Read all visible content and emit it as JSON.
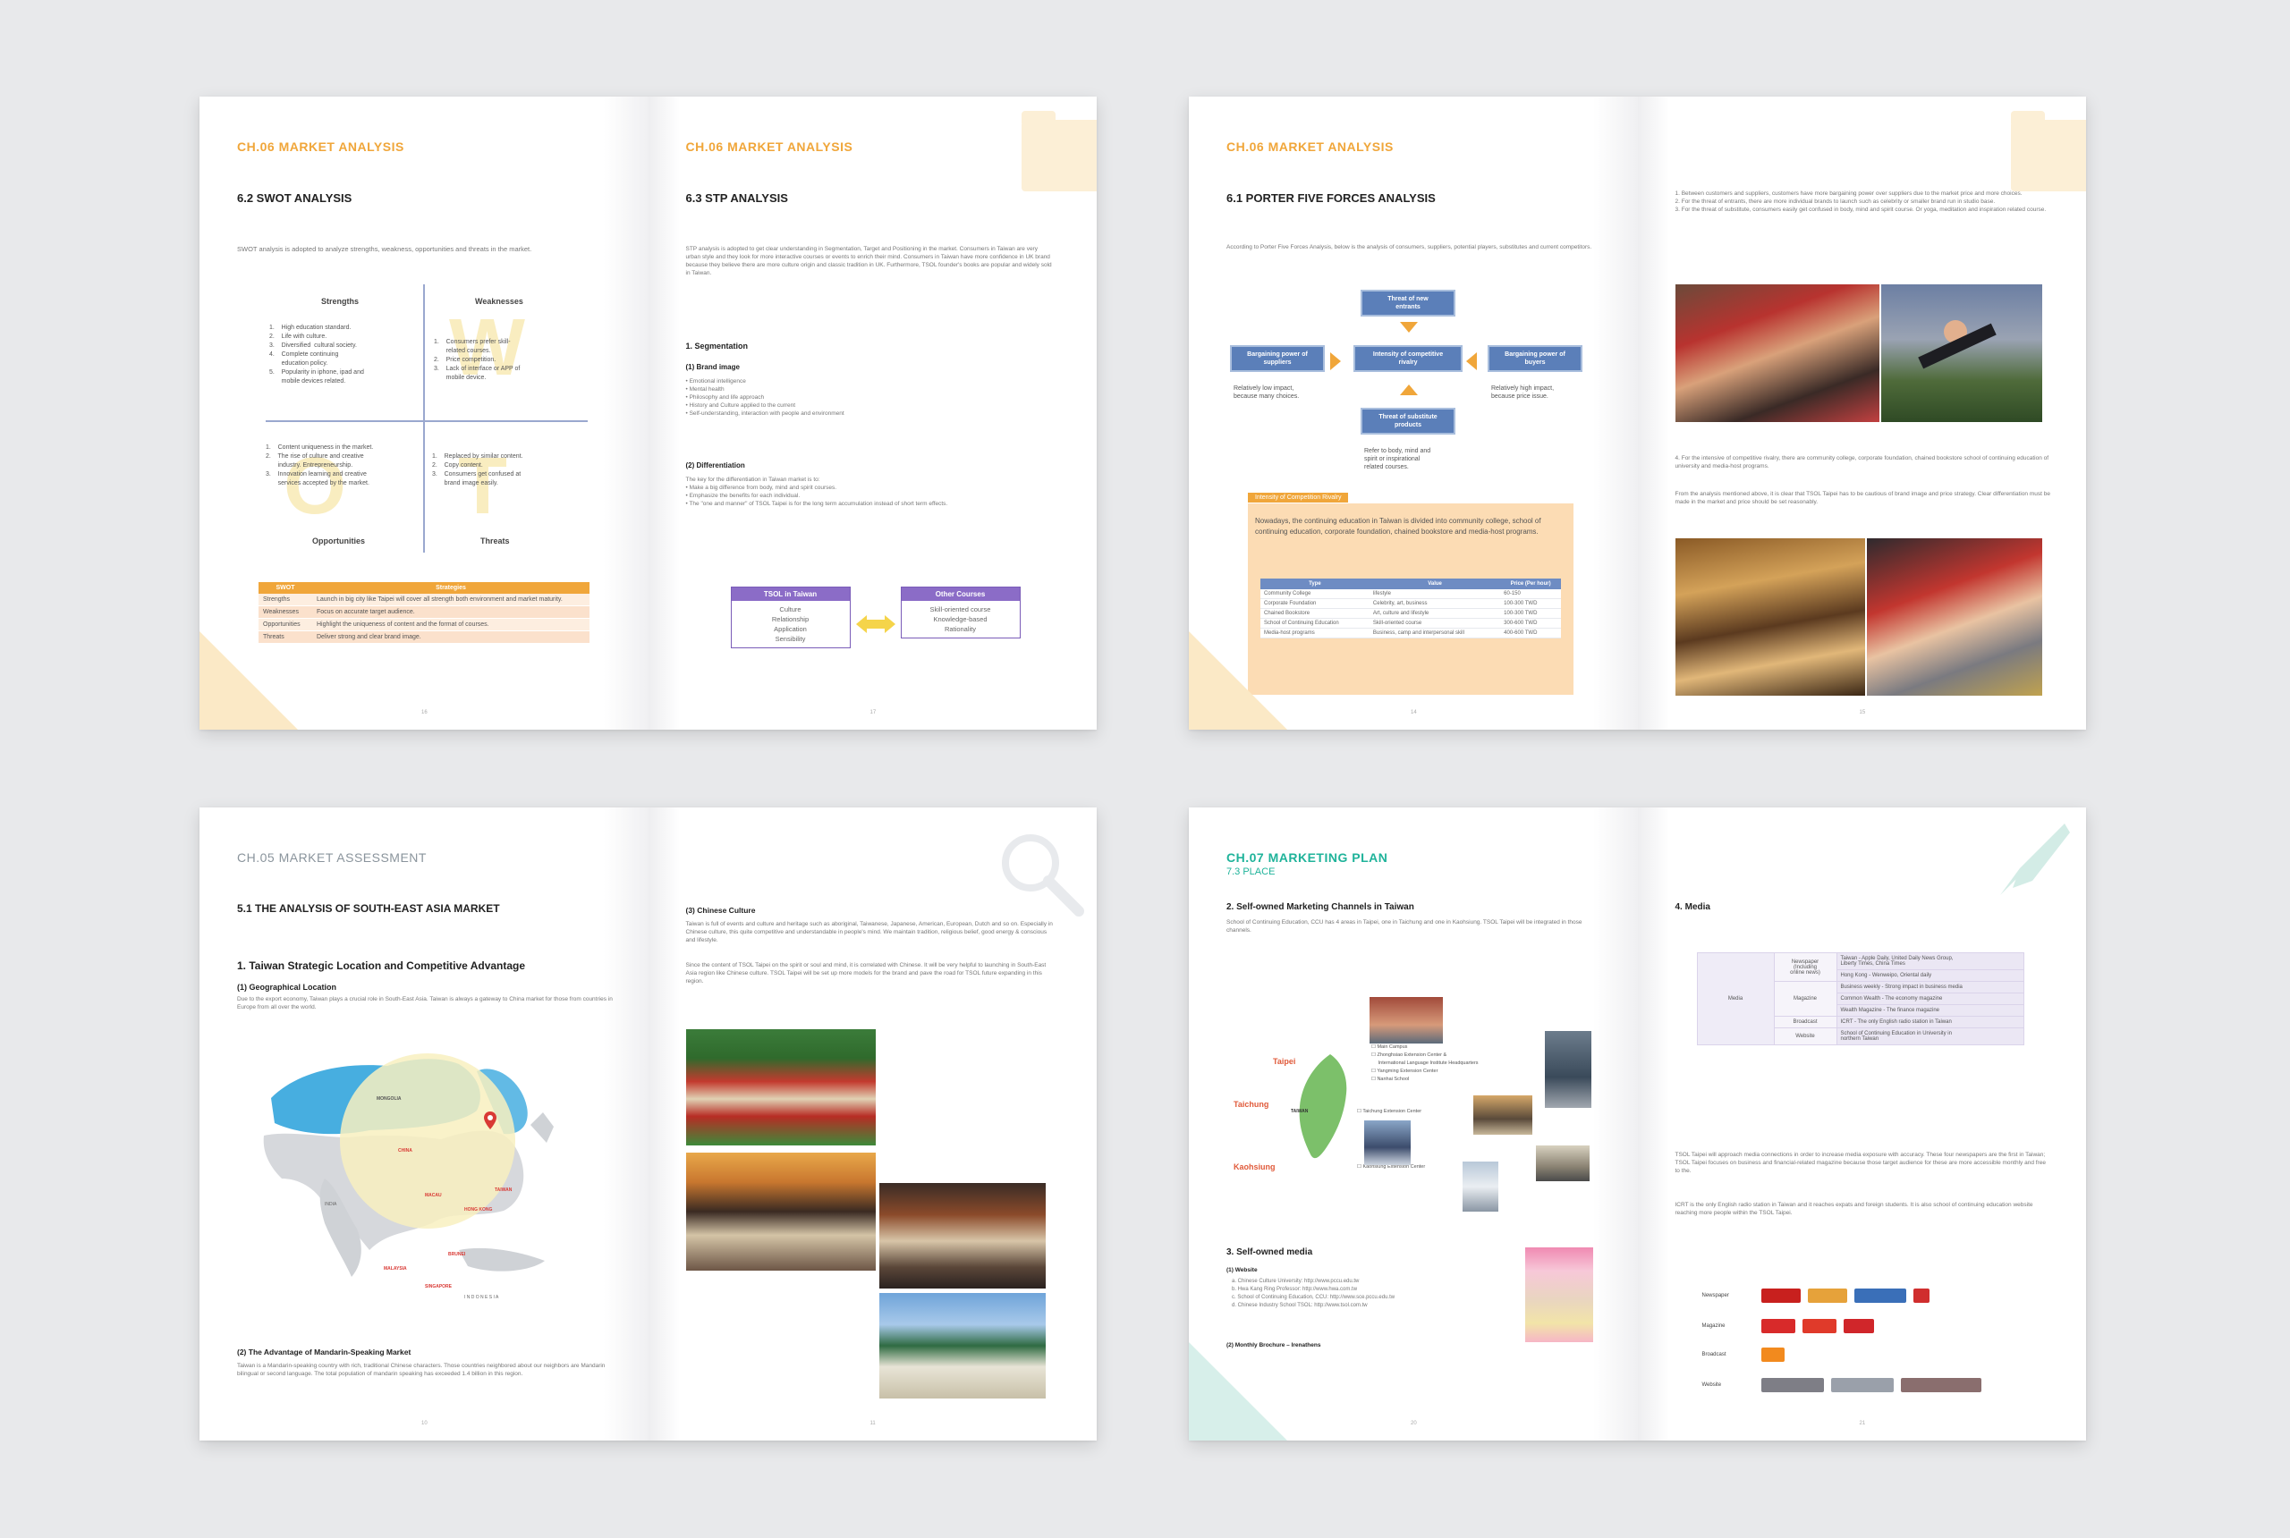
{
  "spread1": {
    "left": {
      "chapter": "CH.06  MARKET ANALYSIS",
      "section": "6.2  SWOT ANALYSIS",
      "intro": "SWOT analysis is adopted to analyze strengths, weakness, opportunities and threats in the market.",
      "quadrants": {
        "strengths": "Strengths",
        "weaknesses": "Weaknesses",
        "opportunities": "Opportunities",
        "threats": "Threats"
      },
      "strengths_list": "1.    High education standard.\n2.    Life with culture.\n3.    Diversified  cultural society.\n4.    Complete continuing\n       education policy.\n5.    Popularity in iphone, ipad and\n       mobile devices related.",
      "weaknesses_list": "1.    Consumers prefer skill-\n       related courses.\n2.    Price competition.\n3.    Lack of interface or APP of\n       mobile device.",
      "opportunities_list": "1.    Content uniqueness in the market.\n2.    The rise of culture and creative\n       industry. Entrepreneurship.\n3.    Innovation learning and creative\n       services accepted by the market.",
      "threats_list": "1.    Replaced by similar content.\n2.    Copy content.\n3.    Consumers get confused at\n       brand image easily.",
      "table_headers": [
        "SWOT",
        "Strategies"
      ],
      "table_rows": [
        [
          "Strengths",
          "Launch in big city like Taipei will cover all strength both environment and market maturity."
        ],
        [
          "Weaknesses",
          "Focus on accurate target audience."
        ],
        [
          "Opportunities",
          "Highlight the uniqueness of content and the format of courses."
        ],
        [
          "Threats",
          "Deliver strong and clear brand image."
        ]
      ],
      "page_number": "16"
    },
    "right": {
      "chapter": "CH.06  MARKET ANALYSIS",
      "section": "6.3  STP ANALYSIS",
      "intro": "STP analysis is adopted to get clear understanding in Segmentation, Target and Positioning in the market. Consumers in Taiwan are very urban style and they look for more interactive courses or events to enrich their mind. Consumers in Taiwan have more confidence in UK brand because they believe there are more culture origin and classic tradition in UK. Furthermore, TSOL founder's books are popular and widely sold in Taiwan.",
      "seg_title": "1. Segmentation",
      "brand_title": "(1) Brand image",
      "brand_list": "• Emotional intelligence\n• Mental health\n• Philosophy and life approach\n• History and Culture applied to the current\n• Self-understanding, interaction with people and environment",
      "diff_title": "(2) Differentiation",
      "diff_text": "The key for the differentiation in Taiwan market is to:\n• Make a big difference from body, mind and spirit courses.\n• Emphasize the benefits for each individual.\n• The \"one and manner\" of TSOL Taipei is for the long term accumulation instead of short term effects.",
      "box1_title": "TSOL in Taiwan",
      "box1_items": "Culture\nRelationship\nApplication\nSensibility",
      "box2_title": "Other Courses",
      "box2_items": "Skill-oriented course\nKnowledge-based\nRationality",
      "page_number": "17"
    }
  },
  "spread2": {
    "left": {
      "chapter": "CH.06  MARKET ANALYSIS",
      "section": "6.1  PORTER FIVE FORCES ANALYSIS",
      "intro": "According to Porter Five Forces Analysis, below is the analysis of consumers, suppliers, potential players, substitutes and current competitors.",
      "boxes": {
        "new_entrants": "Threat of new\nentrants",
        "suppliers": "Bargaining power of\nsuppliers",
        "rivalry": "Intensity of competitive\nrivalry",
        "buyers": "Bargaining power of\nbuyers",
        "substitutes": "Threat of substitute\nproducts"
      },
      "supplier_note": "Relatively low impact,\nbecause many choices.",
      "buyer_note": "Relatively high impact,\nbecause price issue.",
      "substitute_note": "Refer to body, mind and\nspirit or inspirational\nrelated courses.",
      "note_tag": "Intensity of Competition Rivalry",
      "note_text": "Nowadays, the continuing education in Taiwan is divided into community college, school of continuing education, corporate foundation, chained bookstore and media-host programs.",
      "table_headers": [
        "Type",
        "Value",
        "Price (Per hour)"
      ],
      "table_rows": [
        [
          "Community College",
          "lifestyle",
          "60-150"
        ],
        [
          "Corporate Foundation",
          "Celebrity, art, business",
          "100-300 TWD"
        ],
        [
          "Chained Bookstore",
          "Art, culture and lifestyle",
          "100-300 TWD"
        ],
        [
          "School of Continuing Education",
          "Skill-oriented course",
          "300-600 TWD"
        ],
        [
          "Media-host programs",
          "Business, camp and interpersonal skill",
          "400-600 TWD"
        ]
      ],
      "page_number": "14"
    },
    "right": {
      "text1": "1. Between customers and suppliers, customers have more bargaining power over suppliers due to the market price and more choices.\n2. For the threat of entrants, there are more individual brands to launch such as celebrity or smaller brand run in studio base.\n3. For the threat of substitute, consumers easily get confused in body, mind and spirit course. Or yoga, meditation and inspiration related course.",
      "text2": "4. For the intensive of competitive rivalry, there are community college, corporate foundation, chained bookstore school of continuing education of university and media-host programs.",
      "text3": "From the analysis mentioned above, it is clear that TSOL Taipei has to be cautious of brand image and price strategy. Clear differentiation must be made in the market and price should be set reasonably.",
      "page_number": "15"
    }
  },
  "spread3": {
    "left": {
      "chapter": "CH.05  MARKET ASSESSMENT",
      "section": "5.1  THE ANALYSIS OF SOUTH-EAST ASIA MARKET",
      "sub1": "1. Taiwan Strategic Location and Competitive Advantage",
      "sub2": "(1) Geographical Location",
      "text1": "Due to the export economy, Taiwan plays a crucial role in South-East Asia. Taiwan is always a gateway to China market for those from countries in Europe from all over the world.",
      "map_labels": {
        "mongolia": "MONGOLIA",
        "china": "CHINA",
        "india": "INDIA",
        "taiwan": "TAIWAN",
        "macau": "MACAU",
        "hongkong": "HONG KONG",
        "brunei": "BRUNEI",
        "malaysia": "MALAYSIA",
        "singapore": "SINGAPORE",
        "indonesia": "I N D O N E S I A"
      },
      "sub3": "(2) The Advantage of Mandarin-Speaking Market",
      "text2": "Taiwan is a Mandarin-speaking country with rich, traditional Chinese characters. Those countries neighbored about our neighbors are Mandarin bilingual or second language. The total population of mandarin speaking has exceeded 1.4 billion in this region.",
      "page_number": "10"
    },
    "right": {
      "sub": "(3) Chinese Culture",
      "text1": "Taiwan is full of events and culture and heritage such as aboriginal, Taiwanese, Japanese, American, European, Dutch and so on. Especially in Chinese culture, this quite competitive and understandable in people's mind. We maintain tradition, religious belief, good energy & conscious and lifestyle.",
      "text2": "Since the content of TSOL Taipei on the spirit or soul and mind, it is correlated with Chinese. It will be very helpful to launching in South-East Asia region like Chinese culture. TSOL Taipei will be set up more models for the brand and pave the road for TSOL future expanding in this region.",
      "page_number": "11"
    }
  },
  "spread4": {
    "left": {
      "chapter": "CH.07  MARKETING PLAN",
      "chapter_sub": "7.3  PLACE",
      "sub1": "2. Self-owned Marketing Channels in Taiwan",
      "text1": "School of Continuing Education, CCU has 4 areas in Taipei, one in Taichung and one in Kaohsiung. TSOL Taipei will be integrated in those channels.",
      "cities": {
        "taipei": "Taipei",
        "taichung": "Taichung",
        "kaohsiung": "Kaohsiung",
        "taiwan": "TAIWAN"
      },
      "campus_list": "☐ Main Campus\n☐ Zhonghsiao Extension Center &\n     International Language Institute Headquarters\n☐ Yangming Extension Center\n☐ Nanhai School",
      "taichung_center": "☐ Taichung Extension Center",
      "kaohsiung_center": "☐ Kaohsiung Extension Center",
      "sub2": "3. Self-owned media",
      "sub3": "(1) Website",
      "websites": "a. Chinese Culture University: http://www.pccu.edu.tw\nb. Hwa Kang Ring Professor: http://www.hwa.com.tw\nc. School of Continuing Education, CCU: http://www.sce.pccu.edu.tw\nd. Chinese Industry School TSOL: http://www.tsol.com.tw",
      "sub4": "(2) Monthly Brochure – Irenathens",
      "page_number": "20"
    },
    "right": {
      "sub": "4. Media",
      "media_label": "Media",
      "rows": [
        [
          "Newspaper\n(Including\nonline news)",
          "Taiwan - Apple Daily, United Daily News Group,\nLiberty Times, China Times"
        ],
        [
          "",
          "Hong Kong - Wenweipo, Oriental daily"
        ],
        [
          "Magazine",
          "Business weekly - Strong impact in business media"
        ],
        [
          "",
          "Common Wealth - The economy magazine"
        ],
        [
          "",
          "Wealth Magazine - The finance magazine"
        ],
        [
          "Broadcast",
          "ICRT - The only English radio station in Taiwan"
        ],
        [
          "Website",
          "School of Continuing Education in University in\nnorthern Taiwan"
        ]
      ],
      "text1": "TSOL Taipei will approach media connections in order to increase media exposure with accuracy. These four newspapers are the first in Taiwan; TSOL Taipei focuses on business and financial-related magazine because those target audience for these are more accessible monthly and free to the.",
      "text2": "ICRT is the only English radio station in Taiwan and it reaches expats and foreign students. It is also school of continuing education website reaching more people within the TSOL Taipei.",
      "logo_labels": [
        "Newspaper",
        "Magazine",
        "Broadcast",
        "Website"
      ],
      "page_number": "21"
    }
  }
}
